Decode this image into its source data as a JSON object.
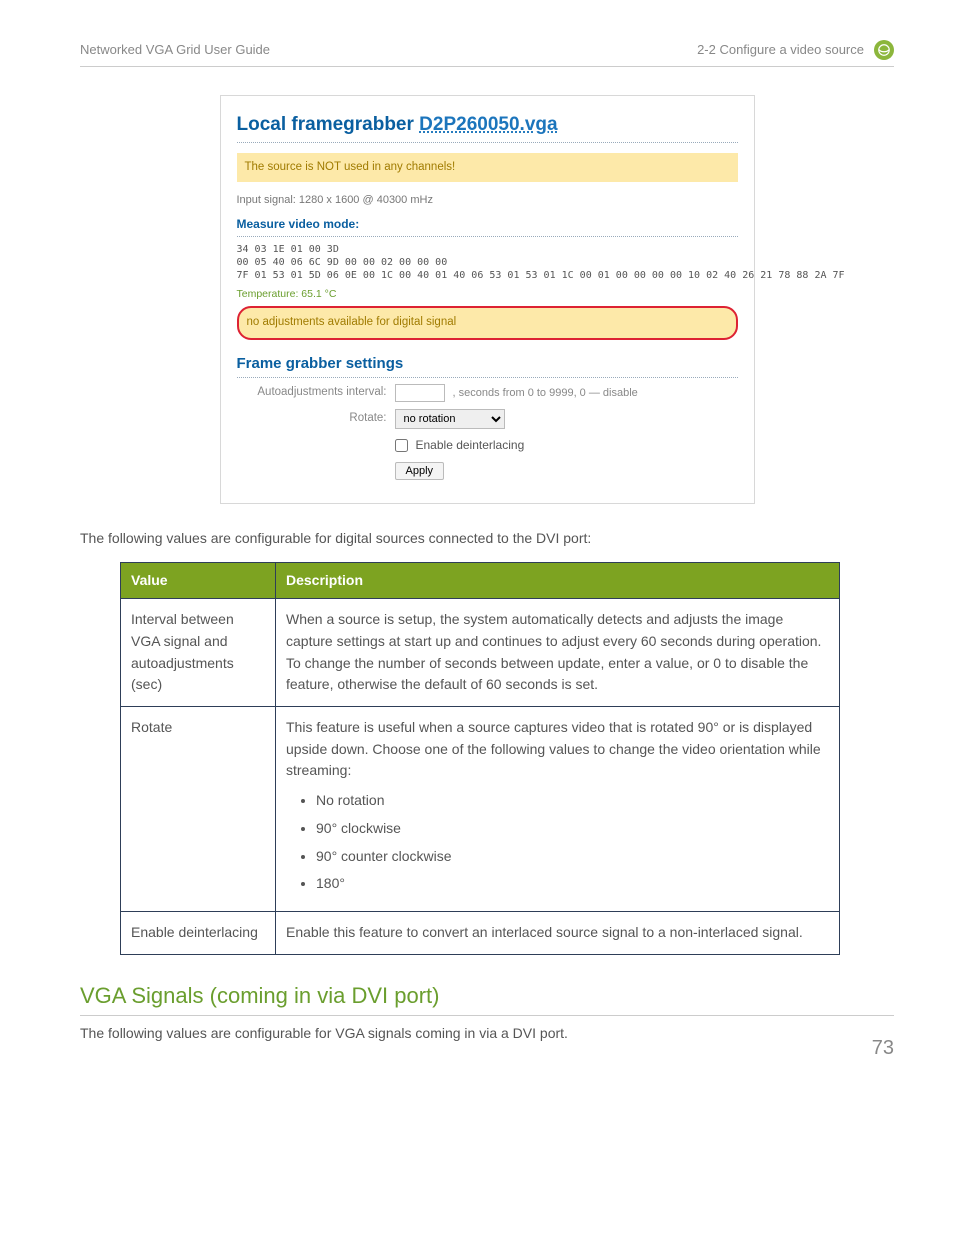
{
  "header": {
    "left": "Networked VGA Grid User Guide",
    "right": "2-2 Configure a video source"
  },
  "screenshot": {
    "title_prefix": "Local framegrabber ",
    "title_link": "D2P260050.vga",
    "warn1": "The source is NOT used in any channels!",
    "input_signal": "Input signal: 1280 x 1600 @ 40300 mHz",
    "measure_heading": "Measure video mode:",
    "hex": "34 03 1E 01 00 3D\n00 05 40 06 6C 9D 00 00 02 00 00 00\n7F 01 53 01 5D 06 0E 00 1C 00 40 01 40 06 53 01 53 01 1C 00 01 00 00 00 00 10 02 40 26 21 78 88 2A 7F",
    "temperature": "Temperature: 65.1 °C",
    "noadj": "no adjustments available for digital signal",
    "fg_heading": "Frame grabber settings",
    "auto_label": "Autoadjustments interval:",
    "auto_hint": ", seconds from 0 to 9999, 0 — disable",
    "rotate_label": "Rotate:",
    "rotate_value": "no rotation",
    "enable_deint_label": "Enable deinterlacing",
    "apply_btn": "Apply"
  },
  "intro_text": "The following values are configurable for digital sources connected to the DVI port:",
  "table": {
    "headers": [
      "Value",
      "Description"
    ],
    "rows": [
      {
        "value": "Interval between VGA signal and autoadjustments (sec)",
        "desc_plain": "When a source is setup, the system automatically detects and adjusts the image capture settings at start up and continues to adjust every 60 seconds during operation. To change the number of seconds between update, enter a value, or 0 to disable the feature, otherwise the default of 60 seconds is set."
      },
      {
        "value": "Rotate",
        "desc_lead": "This feature is useful when a source captures video that is rotated 90° or is displayed upside down. Choose one of the following values to change the video orientation while streaming:",
        "bullets": [
          "No rotation",
          "90° clockwise",
          "90° counter clockwise",
          "180°"
        ]
      },
      {
        "value": "Enable deinterlacing",
        "desc_plain": "Enable this feature to convert an interlaced source signal to a non-interlaced signal."
      }
    ]
  },
  "section_heading": "VGA Signals (coming in via DVI port)",
  "section_text": "The following values are configurable for VGA signals coming in via a DVI port.",
  "page_number": "73"
}
